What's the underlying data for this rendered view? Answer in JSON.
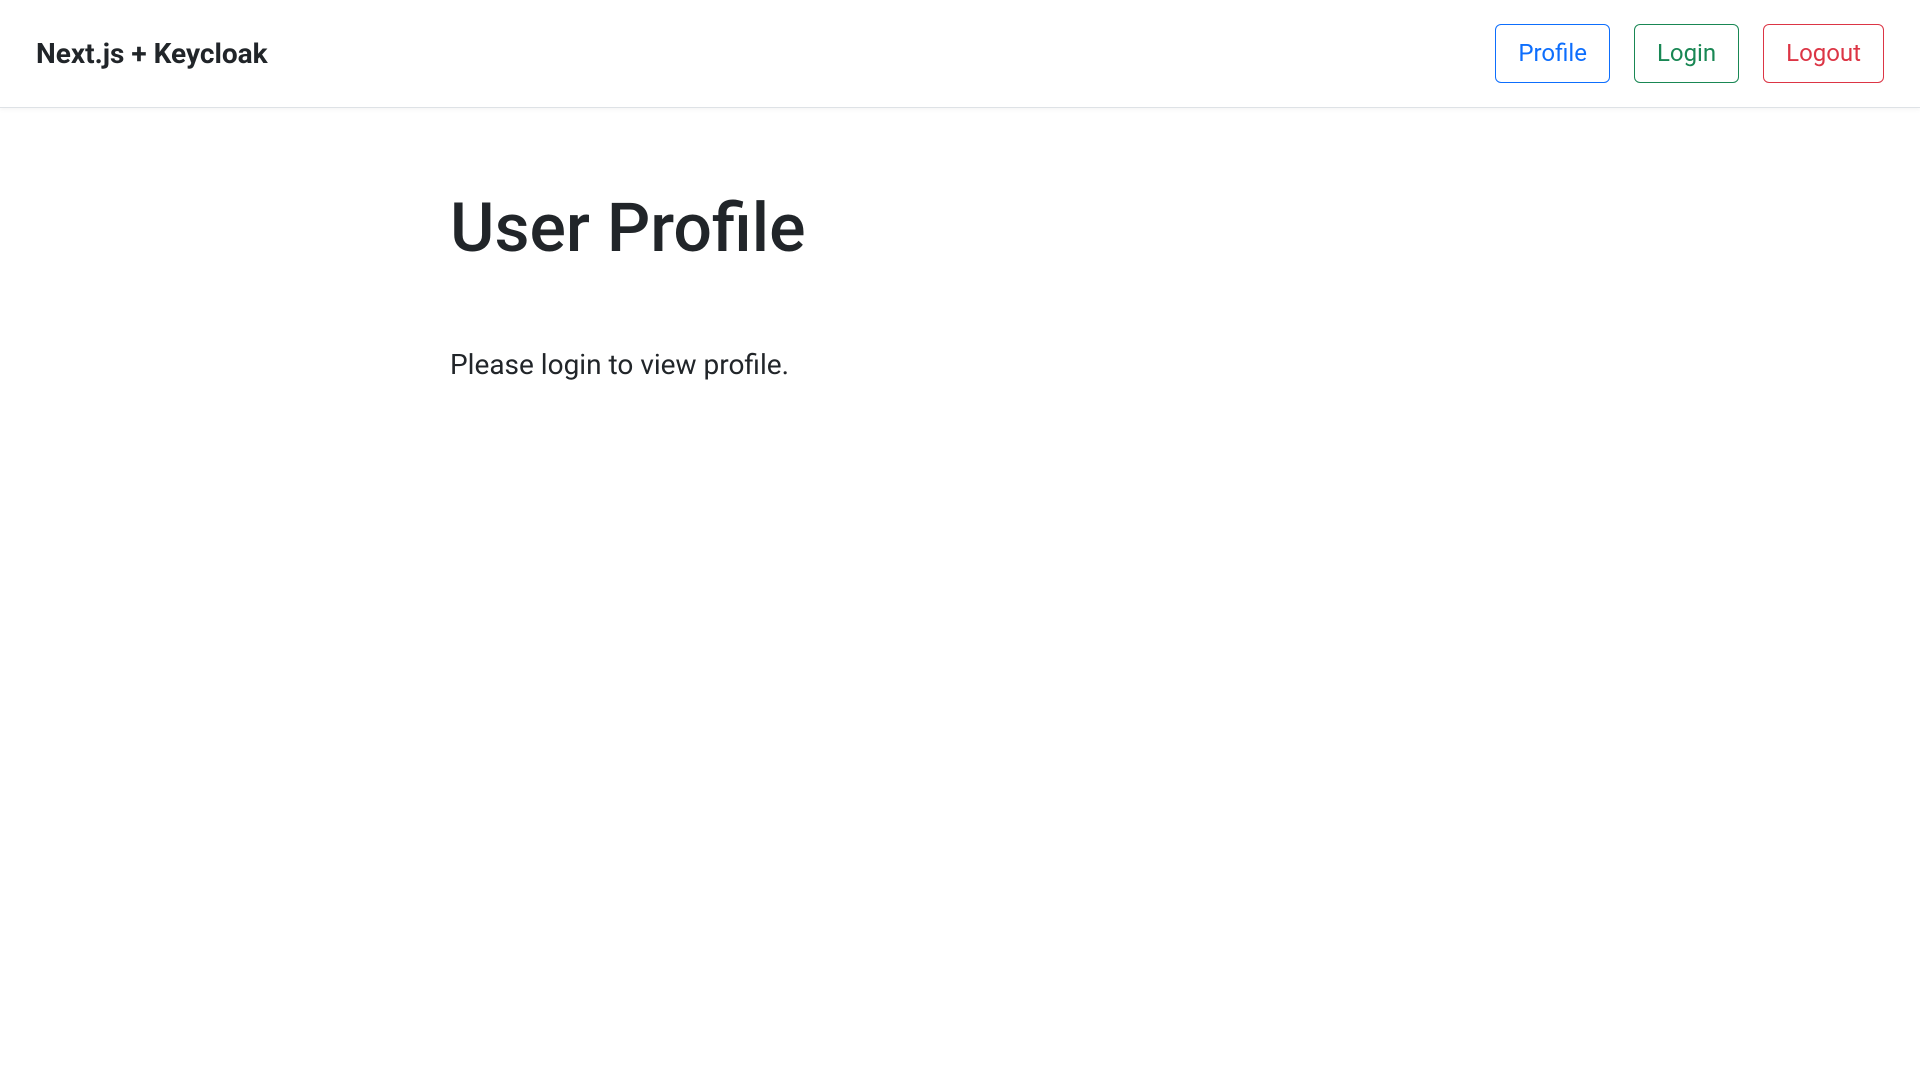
{
  "navbar": {
    "brand": "Next.js + Keycloak",
    "buttons": {
      "profile": "Profile",
      "login": "Login",
      "logout": "Logout"
    }
  },
  "main": {
    "title": "User Profile",
    "message": "Please login to view profile."
  }
}
